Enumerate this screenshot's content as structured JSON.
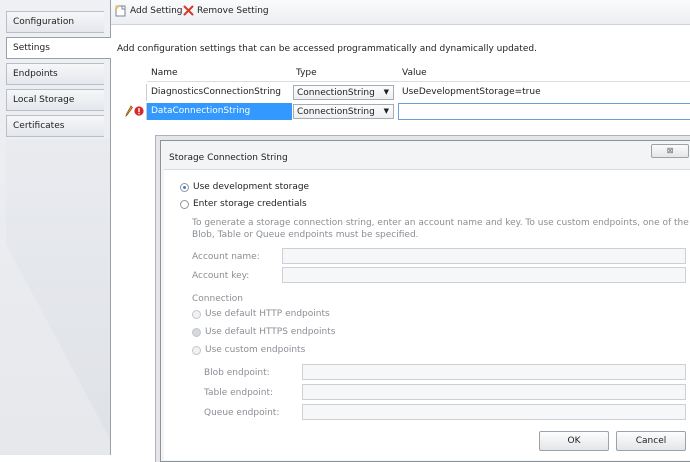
{
  "left_tabs": [
    {
      "label": "Configuration"
    },
    {
      "label": "Settings"
    },
    {
      "label": "Endpoints"
    },
    {
      "label": "Local Storage"
    },
    {
      "label": "Certificates"
    }
  ],
  "toolbar": {
    "add_label": "Add Setting",
    "remove_label": "Remove Setting"
  },
  "description": "Add configuration settings that can be accessed programmatically and dynamically updated.",
  "grid": {
    "headers": {
      "name": "Name",
      "type": "Type",
      "value": "Value"
    },
    "rows": [
      {
        "name": "DiagnosticsConnectionString",
        "type": "ConnectionString",
        "value": "UseDevelopmentStorage=true"
      },
      {
        "name": "DataConnectionString",
        "type": "ConnectionString",
        "value": ""
      }
    ]
  },
  "dialog": {
    "title": "Storage Connection String",
    "close_glyph": "⊠",
    "use_dev_storage": "Use development storage",
    "enter_credentials": "Enter storage credentials",
    "help_text_1": "To generate a storage connection string, enter an account name and key.  To use custom endpoints,  one of the",
    "help_text_2": "Blob, Table or Queue endpoints must be specified.",
    "account_name_label": "Account name:",
    "account_key_label": "Account key:",
    "connection_label": "Connection",
    "http_label": "Use default HTTP endpoints",
    "https_label": "Use default HTTPS endpoints",
    "custom_label": "Use custom endpoints",
    "blob_label": "Blob endpoint:",
    "table_label": "Table endpoint:",
    "queue_label": "Queue endpoint:",
    "ok_label": "OK",
    "cancel_label": "Cancel"
  }
}
